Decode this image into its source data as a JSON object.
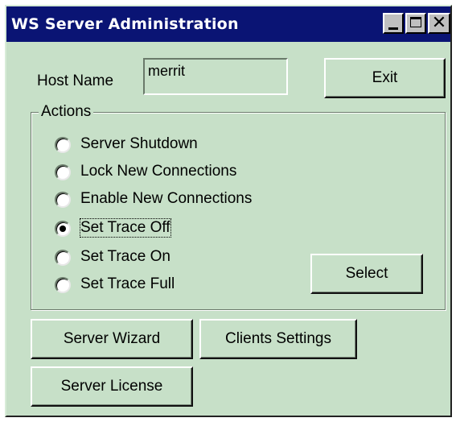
{
  "window": {
    "title": "WS Server Administration"
  },
  "host": {
    "label": "Host Name",
    "value": "merrit"
  },
  "buttons": {
    "exit": "Exit",
    "select": "Select",
    "server_wizard": "Server Wizard",
    "clients_settings": "Clients Settings",
    "server_license": "Server License"
  },
  "actions": {
    "title": "Actions",
    "options": [
      {
        "label": "Server Shutdown",
        "checked": false
      },
      {
        "label": "Lock New Connections",
        "checked": false
      },
      {
        "label": "Enable New Connections",
        "checked": false
      },
      {
        "label": "Set Trace Off",
        "checked": true
      },
      {
        "label": "Set Trace On",
        "checked": false
      },
      {
        "label": "Set Trace Full",
        "checked": false
      }
    ]
  },
  "colors": {
    "window_bg": "#c7e0c8",
    "titlebar_bg": "#0a1474",
    "titlebar_text": "#ffffff"
  },
  "icons": {
    "minimize": "minimize-icon",
    "maximize": "maximize-icon",
    "close": "close-icon"
  }
}
